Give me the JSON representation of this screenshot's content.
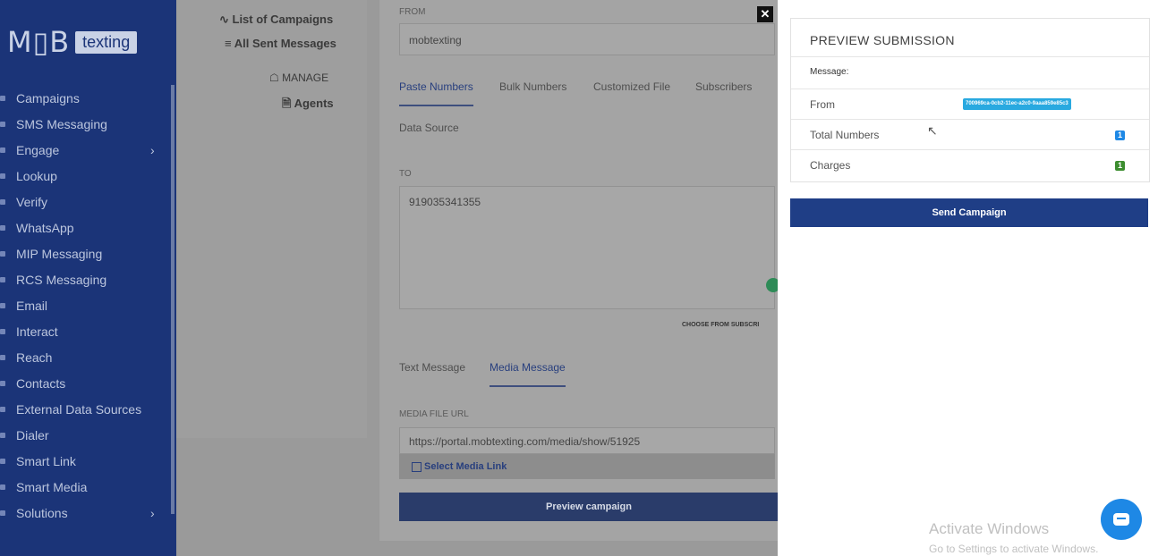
{
  "brand": {
    "mob": "M▯B",
    "texting": "texting"
  },
  "sidebar": {
    "items": [
      {
        "label": "Campaigns"
      },
      {
        "label": "SMS Messaging"
      },
      {
        "label": "Engage",
        "chevron": "›"
      },
      {
        "label": "Lookup"
      },
      {
        "label": "Verify"
      },
      {
        "label": "WhatsApp"
      },
      {
        "label": "MIP Messaging"
      },
      {
        "label": "RCS Messaging"
      },
      {
        "label": "Email"
      },
      {
        "label": "Interact"
      },
      {
        "label": "Reach"
      },
      {
        "label": "Contacts"
      },
      {
        "label": "External Data Sources"
      },
      {
        "label": "Dialer"
      },
      {
        "label": "Smart Link"
      },
      {
        "label": "Smart Media"
      },
      {
        "label": "Solutions",
        "chevron": "›"
      }
    ]
  },
  "submenu": {
    "list_campaigns": "∿ List of Campaigns",
    "all_sent": "≡ All Sent Messages",
    "manage": "☖ MANAGE",
    "agents": "🗎 Agents"
  },
  "form": {
    "from_label": "FROM",
    "from_value": "mobtexting",
    "tabs": [
      "Paste Numbers",
      "Bulk Numbers",
      "Customized File",
      "Subscribers"
    ],
    "data_source_label": "Data Source",
    "to_label": "TO",
    "to_value": "919035341355",
    "choose_from_subscribers": "CHOOSE FROM SUBSCRI",
    "message_tabs": [
      "Text Message",
      "Media Message"
    ],
    "media_url_label": "MEDIA FILE URL",
    "media_url_value": "https://portal.mobtexting.com/media/show/51925",
    "select_media_link": "Select Media Link",
    "preview_button": "Preview campaign"
  },
  "preview": {
    "title": "PREVIEW SUBMISSION",
    "message_label": "Message:",
    "from_label": "From",
    "from_value": "700969ca-0cb2-11ec-a2c0-9aaa859e85c3",
    "total_numbers_label": "Total Numbers",
    "total_numbers_value": "1",
    "charges_label": "Charges",
    "charges_value": "1",
    "send_button": "Send Campaign"
  },
  "windows": {
    "activate_title": "Activate Windows",
    "activate_sub": "Go to Settings to activate Windows."
  },
  "colors": {
    "sidebar_bg": "#1b3478",
    "primary_button": "#1f3e86",
    "badge_blue": "#1e88e5",
    "badge_green": "#3c8d2f"
  }
}
